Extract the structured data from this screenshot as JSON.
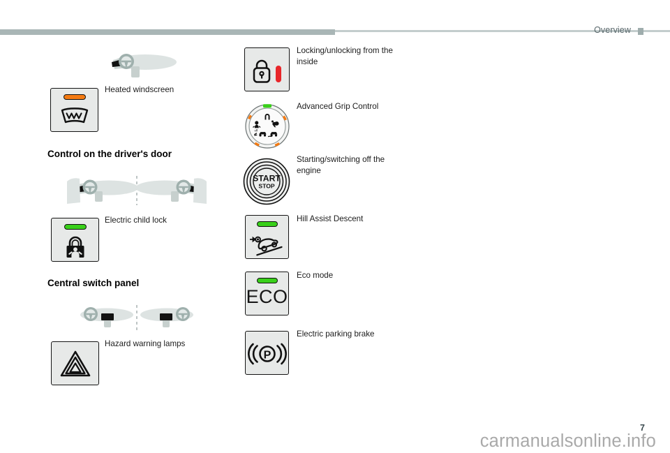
{
  "header": {
    "chapter": "Overview",
    "marker_icon": "square-marker-icon"
  },
  "footer": {
    "page_number": "7",
    "watermark": "carmanualsonline.info"
  },
  "left_column": {
    "items_top": [
      {
        "id": "heated-windscreen",
        "caption": "Heated windscreen",
        "led_color": "#f47a12",
        "glyph": "windscreen-defrost-icon"
      }
    ],
    "sections": [
      {
        "id": "drivers-door",
        "title": "Control on the driver's door",
        "diagram": "dashboard-pair-with-doors",
        "items": [
          {
            "id": "electric-child-lock",
            "caption": "Electric child lock",
            "led_color": "#39d01a",
            "glyph": "child-lock-padlock-icon"
          }
        ]
      },
      {
        "id": "central-switch-panel",
        "title": "Central switch panel",
        "diagram": "dashboard-pair-with-centre-panel",
        "items": [
          {
            "id": "hazard-warning-lamps",
            "caption": "Hazard warning lamps",
            "led_color": null,
            "glyph": "hazard-triangle-icon"
          }
        ]
      }
    ],
    "top_diagram": "dashboard-single-steering-wheel"
  },
  "right_column": {
    "items": [
      {
        "id": "locking-unlocking-inside",
        "caption": "Locking/unlocking from the inside",
        "glyph": "padlock-with-red-bar-icon",
        "accent": "#e8262a"
      },
      {
        "id": "advanced-grip-control",
        "caption": "Advanced Grip Control",
        "glyph": "grip-control-dial-icon",
        "led_color": "#39d01a",
        "accent": "#f47a12",
        "modes": [
          "snow",
          "mud",
          "sand",
          "esp-off",
          "standard"
        ]
      },
      {
        "id": "start-stop-engine",
        "caption": "Starting/switching off the engine",
        "glyph": "start-stop-button-icon",
        "label_top": "START",
        "label_bottom": "STOP"
      },
      {
        "id": "hill-assist-descent",
        "caption": "Hill Assist Descent",
        "glyph": "car-on-slope-icon",
        "led_color": "#39d01a"
      },
      {
        "id": "eco-mode",
        "caption": "Eco mode",
        "glyph": "eco-text-icon",
        "label": "ECO",
        "led_color": "#39d01a"
      },
      {
        "id": "electric-parking-brake",
        "caption": "Electric parking brake",
        "glyph": "parking-brake-icon",
        "label": "((P))"
      }
    ]
  }
}
